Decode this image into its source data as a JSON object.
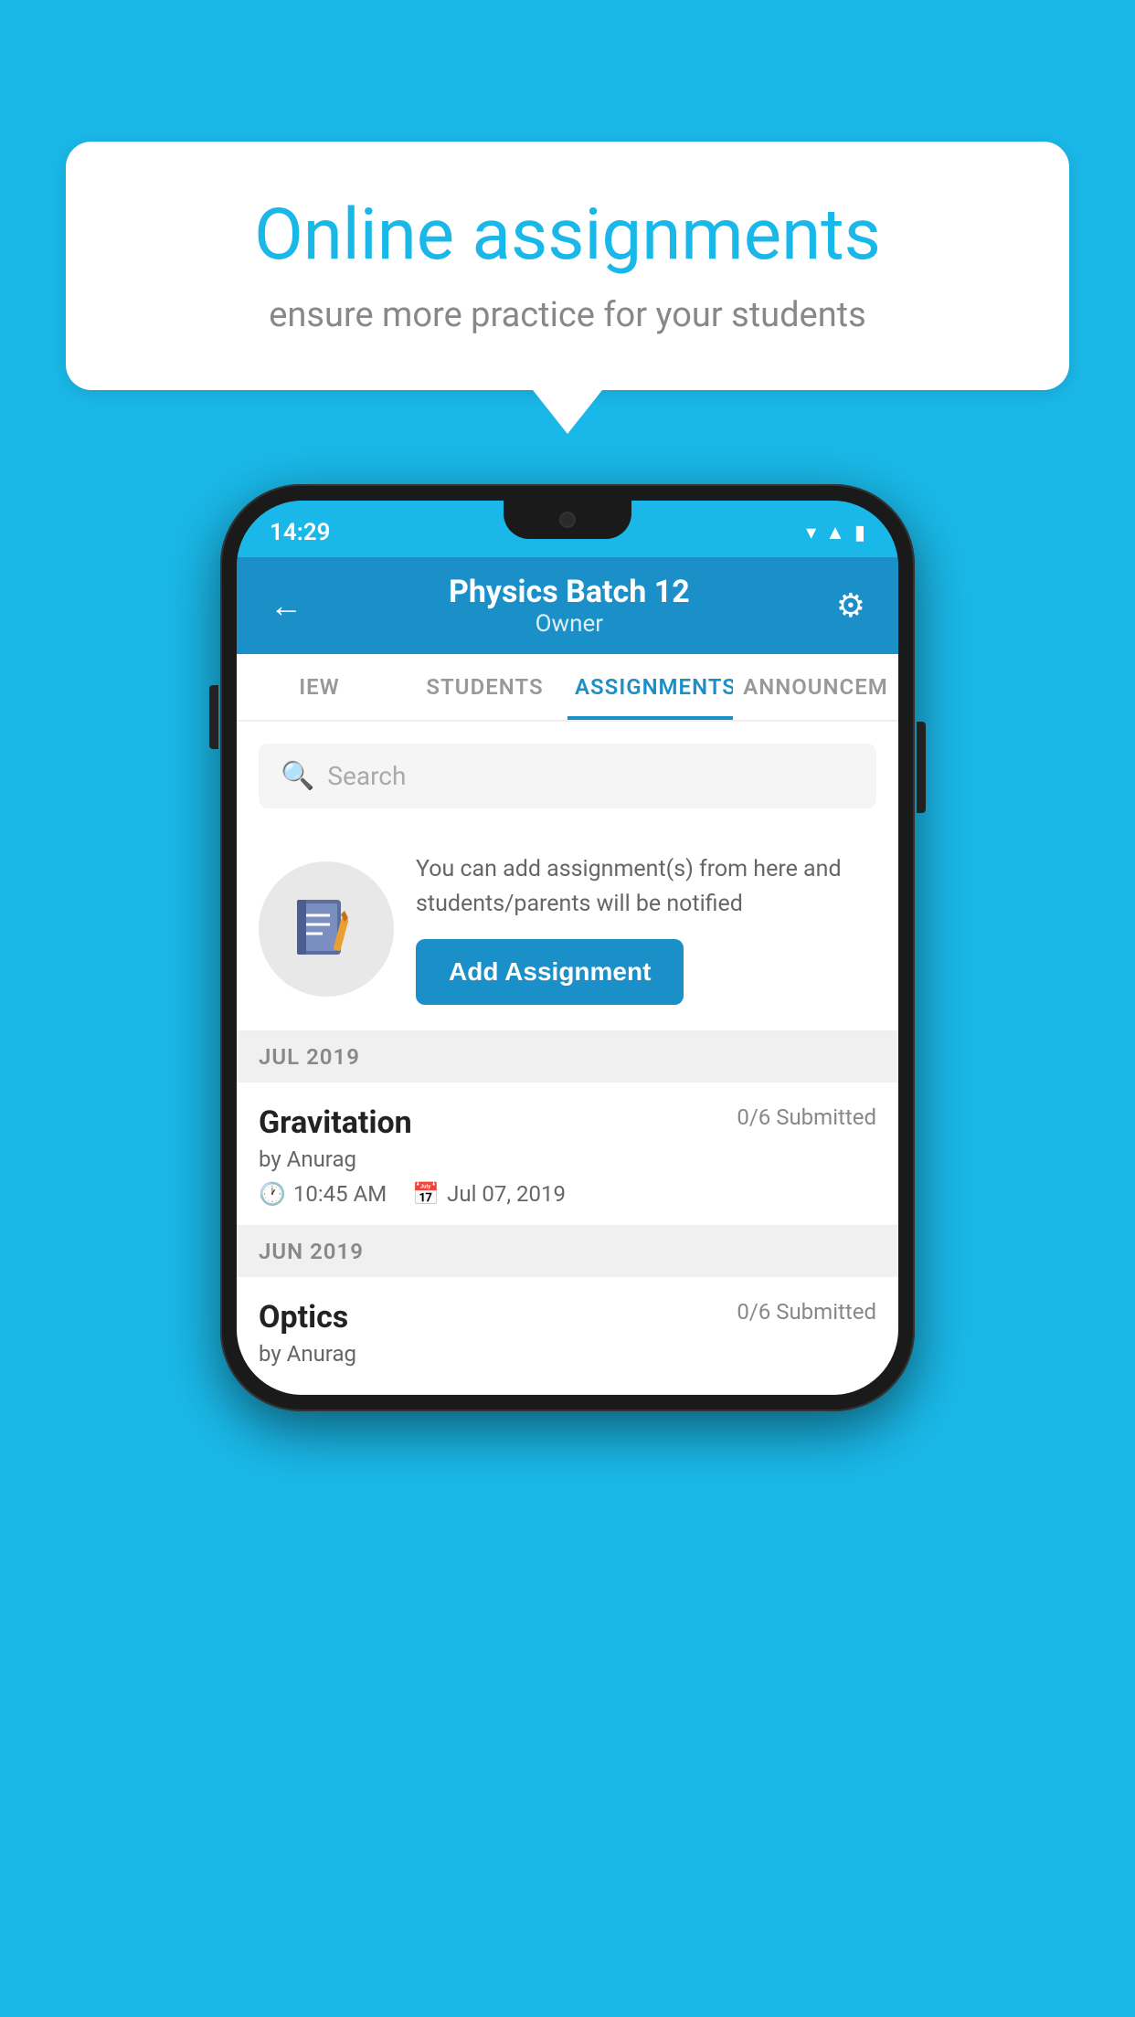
{
  "background_color": "#1ab8e8",
  "speech_bubble": {
    "title": "Online assignments",
    "subtitle": "ensure more practice for your students"
  },
  "phone": {
    "status_bar": {
      "time": "14:29",
      "wifi": "▾",
      "signal": "▲",
      "battery": "▮"
    },
    "header": {
      "back_label": "←",
      "title": "Physics Batch 12",
      "subtitle": "Owner",
      "settings_label": "⚙"
    },
    "tabs": [
      {
        "label": "IEW",
        "active": false
      },
      {
        "label": "STUDENTS",
        "active": false
      },
      {
        "label": "ASSIGNMENTS",
        "active": true
      },
      {
        "label": "ANNOUNCEM",
        "active": false
      }
    ],
    "search": {
      "placeholder": "Search"
    },
    "info_card": {
      "text": "You can add assignment(s) from here and students/parents will be notified",
      "button_label": "Add Assignment"
    },
    "sections": [
      {
        "header": "JUL 2019",
        "assignments": [
          {
            "title": "Gravitation",
            "submitted": "0/6 Submitted",
            "by": "by Anurag",
            "time": "10:45 AM",
            "date": "Jul 07, 2019"
          }
        ]
      },
      {
        "header": "JUN 2019",
        "assignments": [
          {
            "title": "Optics",
            "submitted": "0/6 Submitted",
            "by": "by Anurag",
            "time": "",
            "date": ""
          }
        ]
      }
    ]
  }
}
